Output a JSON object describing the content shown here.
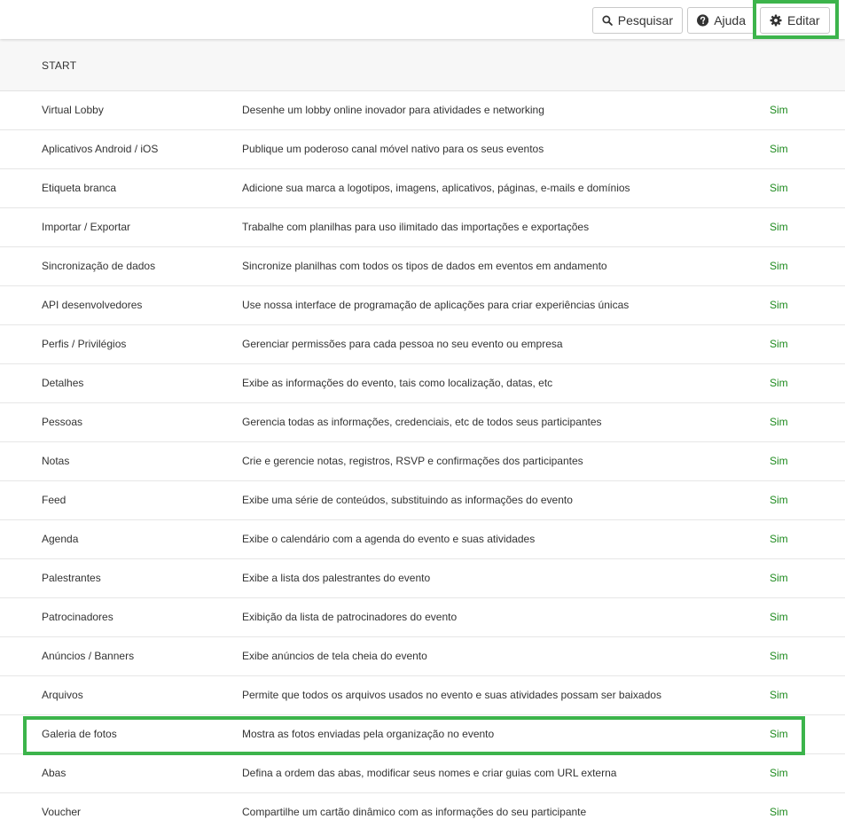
{
  "toolbar": {
    "search_label": "Pesquisar",
    "search_icon": "search-icon",
    "help_label": "Ajuda",
    "help_icon": "question-circle-icon",
    "edit_label": "Editar",
    "edit_icon": "gear-icon"
  },
  "section": {
    "title": "START"
  },
  "colors": {
    "accent_highlight": "#3cb44b",
    "status_yes": "#1e8a1e"
  },
  "features": [
    {
      "name": "Virtual Lobby",
      "description": "Desenhe um lobby online inovador para atividades e networking",
      "status": "Sim"
    },
    {
      "name": "Aplicativos Android / iOS",
      "description": "Publique um poderoso canal móvel nativo para os seus eventos",
      "status": "Sim"
    },
    {
      "name": "Etiqueta branca",
      "description": "Adicione sua marca a logotipos, imagens, aplicativos, páginas, e-mails e domínios",
      "status": "Sim"
    },
    {
      "name": "Importar / Exportar",
      "description": "Trabalhe com planilhas para uso ilimitado das importações e exportações",
      "status": "Sim"
    },
    {
      "name": "Sincronização de dados",
      "description": "Sincronize planilhas com todos os tipos de dados em eventos em andamento",
      "status": "Sim"
    },
    {
      "name": "API desenvolvedores",
      "description": "Use nossa interface de programação de aplicações para criar experiências únicas",
      "status": "Sim"
    },
    {
      "name": "Perfis / Privilégios",
      "description": "Gerenciar permissões para cada pessoa no seu evento ou empresa",
      "status": "Sim"
    },
    {
      "name": "Detalhes",
      "description": "Exibe as informações do evento, tais como localização, datas, etc",
      "status": "Sim"
    },
    {
      "name": "Pessoas",
      "description": "Gerencia todas as informações, credenciais, etc de todos seus participantes",
      "status": "Sim"
    },
    {
      "name": "Notas",
      "description": "Crie e gerencie notas, registros, RSVP e confirmações dos participantes",
      "status": "Sim"
    },
    {
      "name": "Feed",
      "description": "Exibe uma série de conteúdos, substituindo as informações do evento",
      "status": "Sim"
    },
    {
      "name": "Agenda",
      "description": "Exibe o calendário com a agenda do evento e suas atividades",
      "status": "Sim"
    },
    {
      "name": "Palestrantes",
      "description": "Exibe a lista dos palestrantes do evento",
      "status": "Sim"
    },
    {
      "name": "Patrocinadores",
      "description": "Exibição da lista de patrocinadores do evento",
      "status": "Sim"
    },
    {
      "name": "Anúncios / Banners",
      "description": "Exibe anúncios de tela cheia do evento",
      "status": "Sim"
    },
    {
      "name": "Arquivos",
      "description": "Permite que todos os arquivos usados no evento e suas atividades possam ser baixados",
      "status": "Sim"
    },
    {
      "name": "Galeria de fotos",
      "description": "Mostra as fotos enviadas pela organização no evento",
      "status": "Sim"
    },
    {
      "name": "Abas",
      "description": "Defina a ordem das abas, modificar seus nomes e criar guias com URL externa",
      "status": "Sim"
    },
    {
      "name": "Voucher",
      "description": "Compartilhe um cartão dinâmico com as informações do seu participante",
      "status": "Sim"
    }
  ]
}
